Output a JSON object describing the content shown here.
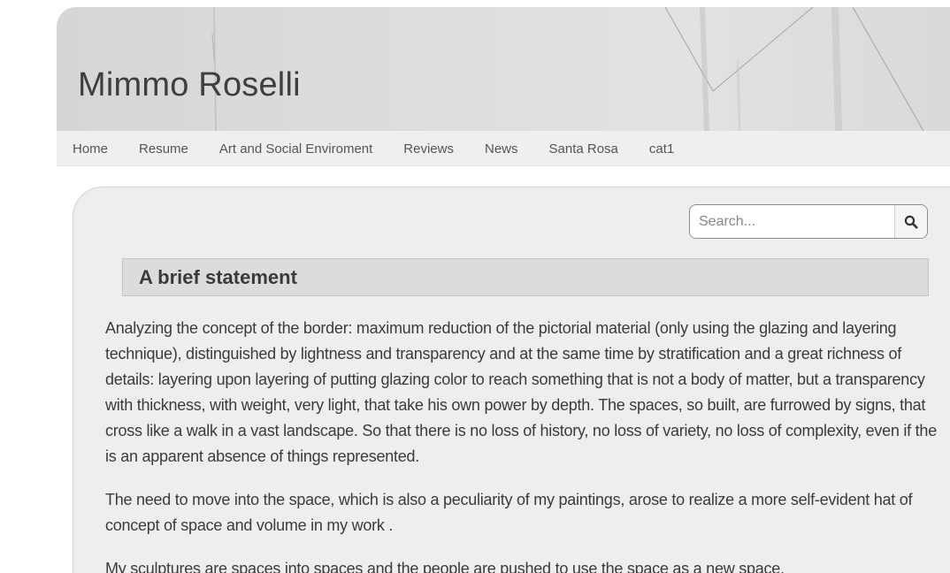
{
  "site": {
    "title": "Mimmo Roselli"
  },
  "nav": {
    "items": [
      {
        "label": "Home"
      },
      {
        "label": "Resume"
      },
      {
        "label": "Art and Social Enviroment"
      },
      {
        "label": "Reviews"
      },
      {
        "label": "News"
      },
      {
        "label": "Santa Rosa"
      },
      {
        "label": "cat1"
      }
    ]
  },
  "search": {
    "placeholder": "Search...",
    "value": "",
    "icon": "search-icon"
  },
  "main": {
    "heading": "A brief statement",
    "paragraphs": [
      "Analyzing the concept of the border: maximum reduction of the pictorial material (only using the glazing and layering technique), distinguished by lightness and transparency and at the same time by stratification and a great richness of details: layering upon layering of putting glazing color to reach something that is not a body of matter, but a transparency with thickness, with weight, very light, that take his own power by depth. The spaces, so built, are furrowed by signs, that cross like a walk in a vast landscape. So that there is no loss of history, no loss of variety, no loss of complexity, even if the is an apparent absence of things represented.",
      "The need to move into the space, which is also a peculiarity of my paintings, arose to realize a more self-evident hat of concept of space and volume in my work .",
      "My sculptures are spaces into spaces and the people are pushed to use the space as a new space."
    ]
  },
  "colors": {
    "header_bg": "#dcdcdc",
    "nav_bg": "#efefef",
    "panel_bg": "#eeeeee",
    "heading_bg": "#dcdcdc",
    "text": "#3b3b3b"
  }
}
